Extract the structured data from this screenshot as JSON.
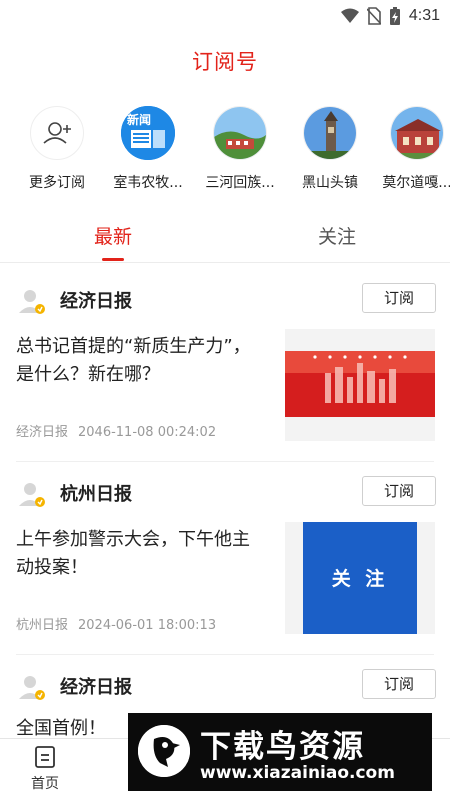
{
  "status": {
    "time": "4:31"
  },
  "title": "订阅号",
  "subscriptions": [
    {
      "label": "更多订阅",
      "icon": "add-user-icon"
    },
    {
      "label": "室韦农牧...",
      "icon": "news-icon",
      "badge": "新闻"
    },
    {
      "label": "三河回族...",
      "icon": "landscape-icon"
    },
    {
      "label": "黑山头镇",
      "icon": "tower-icon"
    },
    {
      "label": "莫尔道嘎...",
      "icon": "building-icon"
    }
  ],
  "tabs": [
    {
      "label": "最新",
      "active": true
    },
    {
      "label": "关注",
      "active": false
    }
  ],
  "cards": [
    {
      "source": "经济日报",
      "subscribe_label": "订阅",
      "headline": "总书记首提的“新质生产力”，是什么？新在哪？",
      "meta_source": "经济日报",
      "meta_time": "2046-11-08 00:24:02"
    },
    {
      "source": "杭州日报",
      "subscribe_label": "订阅",
      "headline": "上午参加警示大会，下午他主动投案！",
      "meta_source": "杭州日报",
      "meta_time": "2024-06-01 18:00:13",
      "thumb_text": "关 注"
    },
    {
      "source": "经济日报",
      "subscribe_label": "订阅",
      "headline": "全国首例！"
    }
  ],
  "bottom_nav": [
    {
      "label": "首页"
    }
  ],
  "watermark": {
    "title": "下载鸟资源",
    "url": "www.xiazainiao.com"
  },
  "colors": {
    "accent": "#e2231a",
    "thumb_blue": "#1b5fc7"
  }
}
